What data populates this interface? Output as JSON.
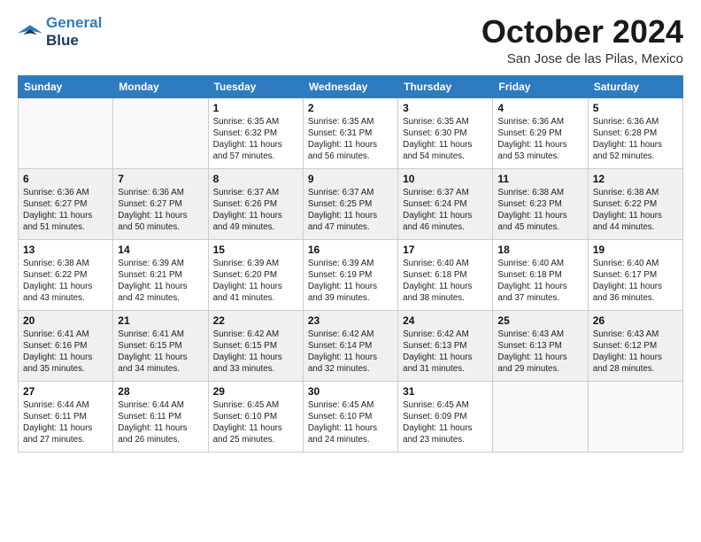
{
  "logo": {
    "line1": "General",
    "line2": "Blue"
  },
  "title": "October 2024",
  "location": "San Jose de las Pilas, Mexico",
  "days_of_week": [
    "Sunday",
    "Monday",
    "Tuesday",
    "Wednesday",
    "Thursday",
    "Friday",
    "Saturday"
  ],
  "weeks": [
    [
      {
        "day": "",
        "info": ""
      },
      {
        "day": "",
        "info": ""
      },
      {
        "day": "1",
        "info": "Sunrise: 6:35 AM\nSunset: 6:32 PM\nDaylight: 11 hours and 57 minutes."
      },
      {
        "day": "2",
        "info": "Sunrise: 6:35 AM\nSunset: 6:31 PM\nDaylight: 11 hours and 56 minutes."
      },
      {
        "day": "3",
        "info": "Sunrise: 6:35 AM\nSunset: 6:30 PM\nDaylight: 11 hours and 54 minutes."
      },
      {
        "day": "4",
        "info": "Sunrise: 6:36 AM\nSunset: 6:29 PM\nDaylight: 11 hours and 53 minutes."
      },
      {
        "day": "5",
        "info": "Sunrise: 6:36 AM\nSunset: 6:28 PM\nDaylight: 11 hours and 52 minutes."
      }
    ],
    [
      {
        "day": "6",
        "info": "Sunrise: 6:36 AM\nSunset: 6:27 PM\nDaylight: 11 hours and 51 minutes."
      },
      {
        "day": "7",
        "info": "Sunrise: 6:36 AM\nSunset: 6:27 PM\nDaylight: 11 hours and 50 minutes."
      },
      {
        "day": "8",
        "info": "Sunrise: 6:37 AM\nSunset: 6:26 PM\nDaylight: 11 hours and 49 minutes."
      },
      {
        "day": "9",
        "info": "Sunrise: 6:37 AM\nSunset: 6:25 PM\nDaylight: 11 hours and 47 minutes."
      },
      {
        "day": "10",
        "info": "Sunrise: 6:37 AM\nSunset: 6:24 PM\nDaylight: 11 hours and 46 minutes."
      },
      {
        "day": "11",
        "info": "Sunrise: 6:38 AM\nSunset: 6:23 PM\nDaylight: 11 hours and 45 minutes."
      },
      {
        "day": "12",
        "info": "Sunrise: 6:38 AM\nSunset: 6:22 PM\nDaylight: 11 hours and 44 minutes."
      }
    ],
    [
      {
        "day": "13",
        "info": "Sunrise: 6:38 AM\nSunset: 6:22 PM\nDaylight: 11 hours and 43 minutes."
      },
      {
        "day": "14",
        "info": "Sunrise: 6:39 AM\nSunset: 6:21 PM\nDaylight: 11 hours and 42 minutes."
      },
      {
        "day": "15",
        "info": "Sunrise: 6:39 AM\nSunset: 6:20 PM\nDaylight: 11 hours and 41 minutes."
      },
      {
        "day": "16",
        "info": "Sunrise: 6:39 AM\nSunset: 6:19 PM\nDaylight: 11 hours and 39 minutes."
      },
      {
        "day": "17",
        "info": "Sunrise: 6:40 AM\nSunset: 6:18 PM\nDaylight: 11 hours and 38 minutes."
      },
      {
        "day": "18",
        "info": "Sunrise: 6:40 AM\nSunset: 6:18 PM\nDaylight: 11 hours and 37 minutes."
      },
      {
        "day": "19",
        "info": "Sunrise: 6:40 AM\nSunset: 6:17 PM\nDaylight: 11 hours and 36 minutes."
      }
    ],
    [
      {
        "day": "20",
        "info": "Sunrise: 6:41 AM\nSunset: 6:16 PM\nDaylight: 11 hours and 35 minutes."
      },
      {
        "day": "21",
        "info": "Sunrise: 6:41 AM\nSunset: 6:15 PM\nDaylight: 11 hours and 34 minutes."
      },
      {
        "day": "22",
        "info": "Sunrise: 6:42 AM\nSunset: 6:15 PM\nDaylight: 11 hours and 33 minutes."
      },
      {
        "day": "23",
        "info": "Sunrise: 6:42 AM\nSunset: 6:14 PM\nDaylight: 11 hours and 32 minutes."
      },
      {
        "day": "24",
        "info": "Sunrise: 6:42 AM\nSunset: 6:13 PM\nDaylight: 11 hours and 31 minutes."
      },
      {
        "day": "25",
        "info": "Sunrise: 6:43 AM\nSunset: 6:13 PM\nDaylight: 11 hours and 29 minutes."
      },
      {
        "day": "26",
        "info": "Sunrise: 6:43 AM\nSunset: 6:12 PM\nDaylight: 11 hours and 28 minutes."
      }
    ],
    [
      {
        "day": "27",
        "info": "Sunrise: 6:44 AM\nSunset: 6:11 PM\nDaylight: 11 hours and 27 minutes."
      },
      {
        "day": "28",
        "info": "Sunrise: 6:44 AM\nSunset: 6:11 PM\nDaylight: 11 hours and 26 minutes."
      },
      {
        "day": "29",
        "info": "Sunrise: 6:45 AM\nSunset: 6:10 PM\nDaylight: 11 hours and 25 minutes."
      },
      {
        "day": "30",
        "info": "Sunrise: 6:45 AM\nSunset: 6:10 PM\nDaylight: 11 hours and 24 minutes."
      },
      {
        "day": "31",
        "info": "Sunrise: 6:45 AM\nSunset: 6:09 PM\nDaylight: 11 hours and 23 minutes."
      },
      {
        "day": "",
        "info": ""
      },
      {
        "day": "",
        "info": ""
      }
    ]
  ]
}
